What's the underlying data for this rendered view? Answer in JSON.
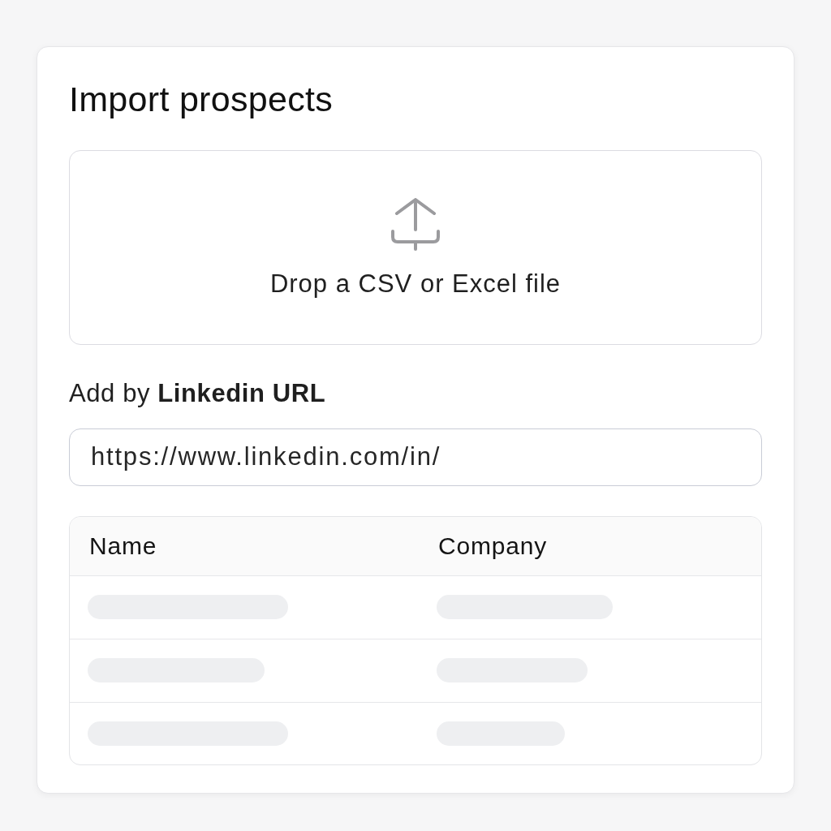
{
  "title": "Import prospects",
  "dropzone": {
    "text": "Drop a CSV or Excel file"
  },
  "linkedin": {
    "label": "Add by **Linkedin URL**",
    "value": "https://www.linkedin.com/in/"
  },
  "table": {
    "columns": [
      "Name",
      "Company"
    ],
    "loading": true
  }
}
